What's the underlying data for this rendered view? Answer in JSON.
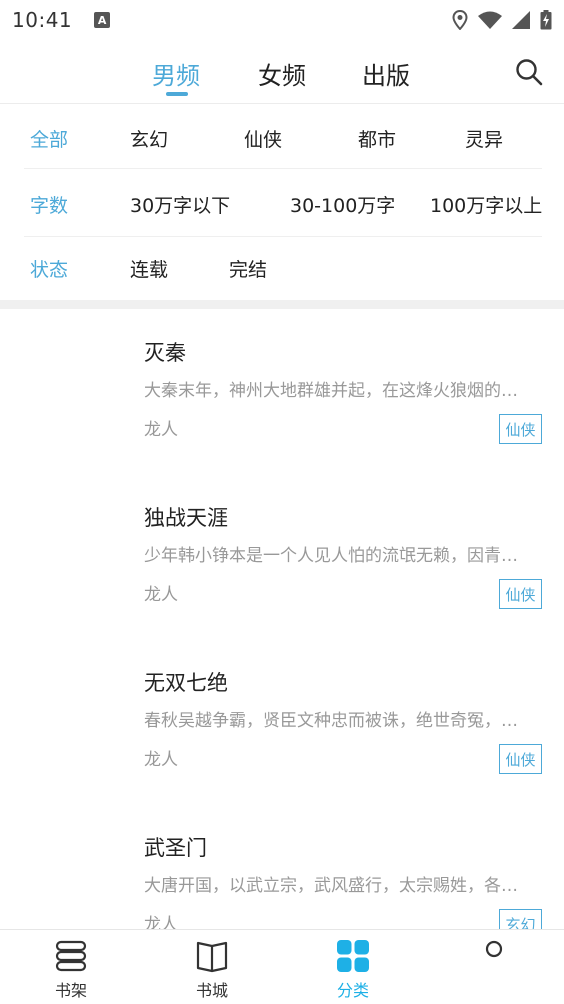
{
  "status_bar": {
    "time": "10:41",
    "notification_letter": "A"
  },
  "top_tabs": [
    {
      "label": "男频",
      "active": true
    },
    {
      "label": "女频",
      "active": false
    },
    {
      "label": "出版",
      "active": false
    }
  ],
  "filters": {
    "genre": {
      "label": "全部",
      "options": [
        "玄幻",
        "仙侠",
        "都市",
        "灵异"
      ]
    },
    "word_count": {
      "label": "字数",
      "options": [
        "30万字以下",
        "30-100万字",
        "100万字以上"
      ]
    },
    "status": {
      "label": "状态",
      "options": [
        "连载",
        "完结"
      ]
    }
  },
  "books": [
    {
      "title": "灭秦",
      "description": "大秦末年，神州大地群雄并起，在这烽火狼烟的…",
      "author": "龙人",
      "tag": "仙侠"
    },
    {
      "title": "独战天涯",
      "description": "少年韩小铮本是一个人见人怕的流氓无赖，因青…",
      "author": "龙人",
      "tag": "仙侠"
    },
    {
      "title": "无双七绝",
      "description": "春秋吴越争霸，贤臣文种忠而被诛，绝世奇冤，…",
      "author": "龙人",
      "tag": "仙侠"
    },
    {
      "title": "武圣门",
      "description": "大唐开国，以武立宗，武风盛行，太宗赐姓，各…",
      "author": "龙人",
      "tag": "玄幻"
    }
  ],
  "bottom_nav": [
    {
      "label": "书架",
      "icon": "bookshelf-icon"
    },
    {
      "label": "书城",
      "icon": "book-icon"
    },
    {
      "label": "分类",
      "icon": "category-grid-icon",
      "active": true
    },
    {
      "label": "",
      "icon": "profile-icon"
    }
  ],
  "colors": {
    "accent": "#4da9d8",
    "nav_active": "#1eb0e6",
    "muted_text": "#999999"
  }
}
